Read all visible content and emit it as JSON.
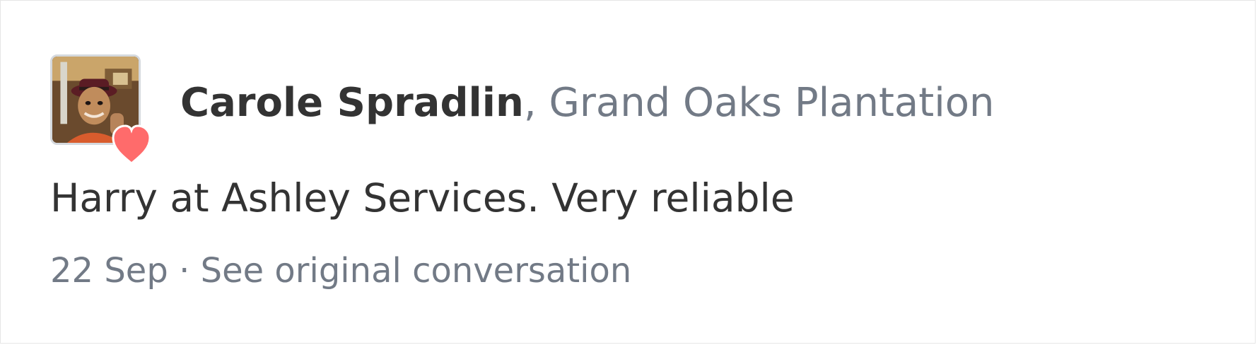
{
  "post": {
    "author": {
      "name": "Carole Spradlin",
      "separator": ",",
      "community": "Grand Oaks Plantation",
      "avatar_icon": "user-photo",
      "badge_icon": "heart-icon",
      "badge_color": "#ff6b6b"
    },
    "message": "Harry at Ashley Services. Very reliable",
    "meta": {
      "date": "22 Sep",
      "separator": "·",
      "conversation_link": "See original conversation"
    }
  },
  "colors": {
    "name_text": "#333333",
    "muted_text": "#727a86",
    "border": "#e6e6e6"
  }
}
